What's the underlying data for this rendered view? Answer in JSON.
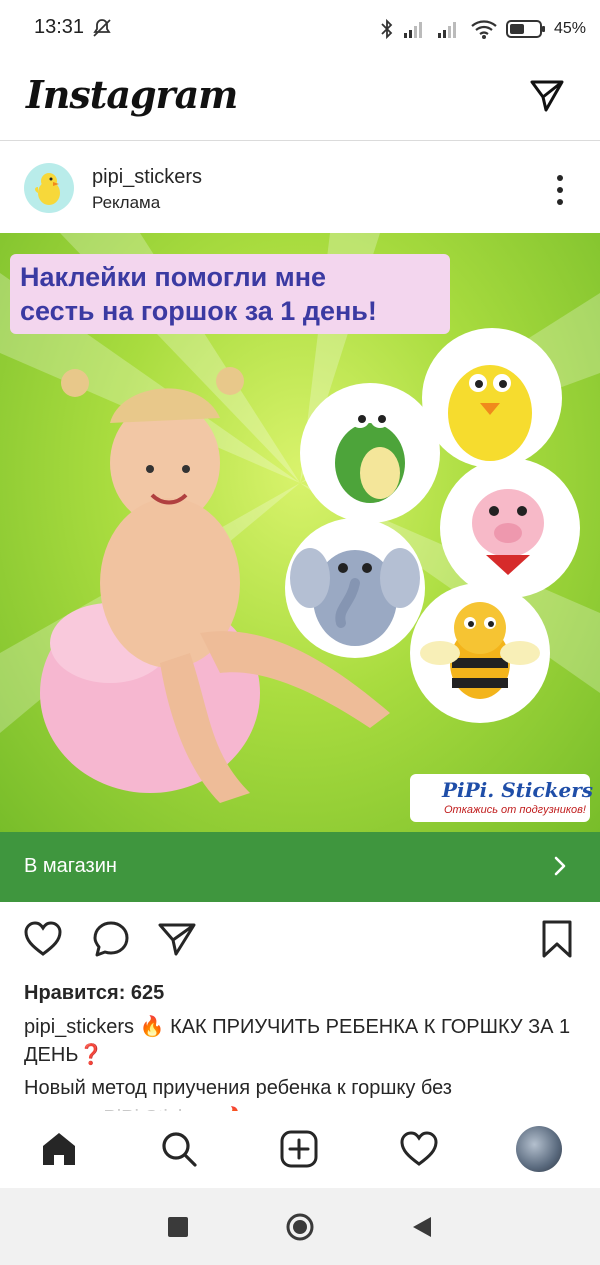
{
  "status_bar": {
    "time": "13:31",
    "battery_percent": "45%",
    "icons": [
      "mute-icon",
      "bluetooth-icon",
      "signal-icon",
      "signal-icon",
      "wifi-icon",
      "battery-icon"
    ]
  },
  "app": {
    "logo_text": "Instagram",
    "header_icons": [
      "direct-message-icon"
    ]
  },
  "post": {
    "username": "pipi_stickers",
    "sponsored_label": "Реклама",
    "image": {
      "headline_line1": "Наклейки помогли мне",
      "headline_line2": "сесть на горшок за 1 день!",
      "brand_name": "PiPi. Stickers",
      "brand_tagline": "Откажись от подгузников!",
      "stickers": [
        "crocodile",
        "chick",
        "pig",
        "elephant",
        "bee"
      ]
    },
    "cta_label": "В магазин",
    "likes": "Нравится: 625",
    "caption_username": "pipi_stickers",
    "caption_text": "🔥 КАК ПРИУЧИТЬ РЕБЕНКА К ГОРШКУ ЗА 1 ДЕНЬ❓",
    "caption_more": "Новый метод приучения ребенка к горшку без",
    "caption_more_faded": "наклеек PiPi.Stickers 🔥"
  },
  "colors": {
    "cta_green": "#3f963e",
    "headline_bg": "#f3d6ee",
    "headline_text": "#3b3aa2",
    "brand_blue": "#1f4ea8"
  }
}
